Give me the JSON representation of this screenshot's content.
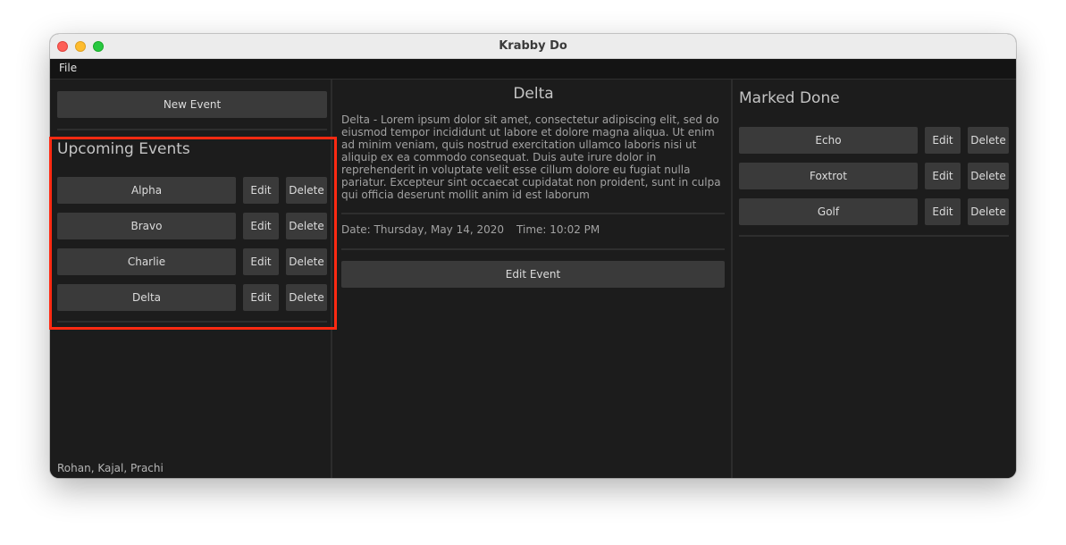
{
  "window": {
    "title": "Krabby Do"
  },
  "menu": {
    "file": "File"
  },
  "left": {
    "new_event": "New Event",
    "upcoming_title": "Upcoming Events",
    "events": [
      {
        "name": "Alpha",
        "edit": "Edit",
        "delete": "Delete"
      },
      {
        "name": "Bravo",
        "edit": "Edit",
        "delete": "Delete"
      },
      {
        "name": "Charlie",
        "edit": "Edit",
        "delete": "Delete"
      },
      {
        "name": "Delta",
        "edit": "Edit",
        "delete": "Delete"
      }
    ],
    "credits": "Rohan, Kajal, Prachi"
  },
  "detail": {
    "title": "Delta",
    "description": "Delta - Lorem ipsum dolor sit amet, consectetur adipiscing elit, sed do eiusmod tempor incididunt ut labore et dolore magna aliqua. Ut enim ad minim veniam, quis nostrud exercitation ullamco laboris nisi ut aliquip ex ea commodo consequat. Duis aute irure dolor in reprehenderit in voluptate velit esse cillum dolore eu fugiat nulla pariatur. Excepteur sint occaecat cupidatat non proident, sunt in culpa qui officia deserunt mollit anim id est laborum",
    "date": "Date: Thursday, May 14, 2020",
    "time": "Time: 10:02 PM",
    "edit_event": "Edit Event"
  },
  "done": {
    "title": "Marked Done",
    "events": [
      {
        "name": "Echo",
        "edit": "Edit",
        "delete": "Delete"
      },
      {
        "name": "Foxtrot",
        "edit": "Edit",
        "delete": "Delete"
      },
      {
        "name": "Golf",
        "edit": "Edit",
        "delete": "Delete"
      }
    ]
  },
  "colors": {
    "highlight": "#ff2a12",
    "window_bg": "#1c1c1c",
    "button_bg": "#3a3a3a"
  }
}
